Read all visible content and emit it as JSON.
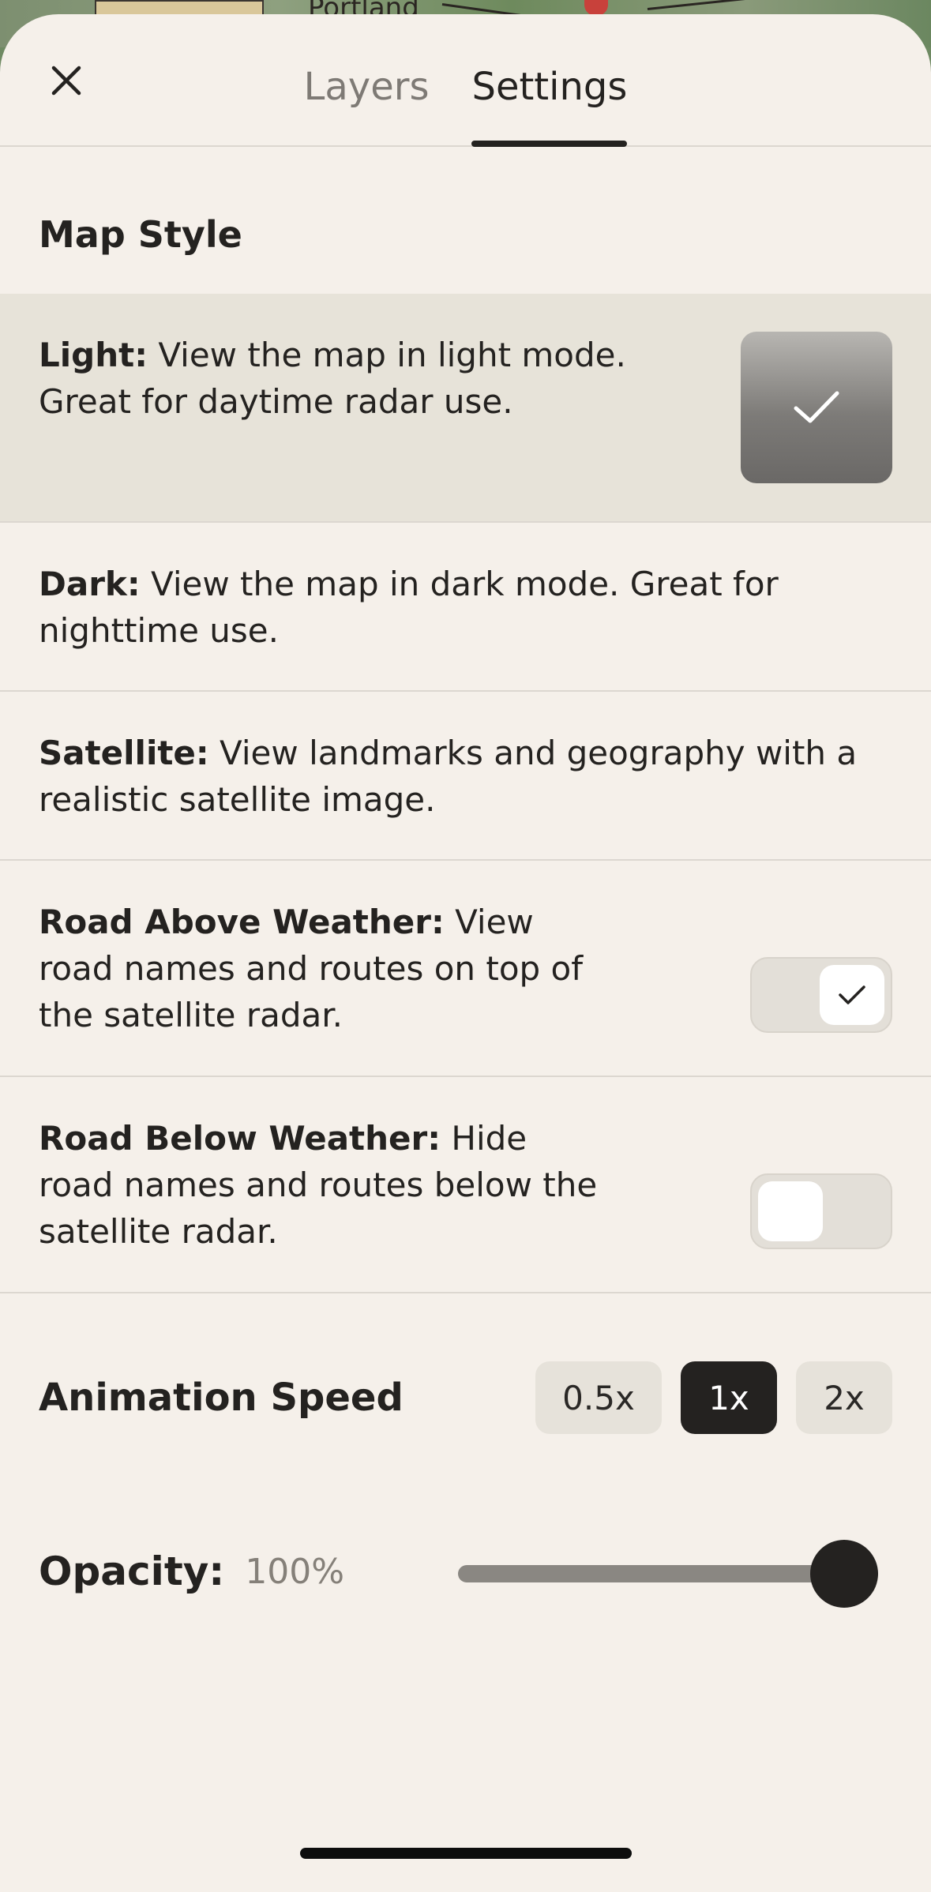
{
  "map": {
    "city_label": "Portland"
  },
  "header": {
    "close_icon": "close-icon",
    "tabs": [
      {
        "label": "Layers",
        "active": false
      },
      {
        "label": "Settings",
        "active": true
      }
    ]
  },
  "map_style": {
    "title": "Map Style",
    "options": [
      {
        "name": "Light:",
        "desc": " View the map in light mode. Great for daytime radar use.",
        "selected": true
      },
      {
        "name": "Dark:",
        "desc": " View the map in dark mode. Great for nighttime use.",
        "selected": false
      },
      {
        "name": "Satellite:",
        "desc": " View landmarks and geography with a realistic satellite image.",
        "selected": false
      }
    ],
    "toggles": [
      {
        "name": "Road Above Weather:",
        "desc": " View road names and routes on top of the satellite radar.",
        "on": true
      },
      {
        "name": "Road Below Weather:",
        "desc": " Hide road names and routes below the satellite radar.",
        "on": false
      }
    ]
  },
  "animation": {
    "label": "Animation Speed",
    "speeds": [
      "0.5x",
      "1x",
      "2x"
    ],
    "selected": "1x"
  },
  "opacity": {
    "label": "Opacity:",
    "value_text": "100%",
    "value": 100
  },
  "colors": {
    "sheet_bg": "#f5f0ea",
    "selected_row": "#e7e3d9",
    "accent_dark": "#242220",
    "muted_text": "#858079"
  }
}
